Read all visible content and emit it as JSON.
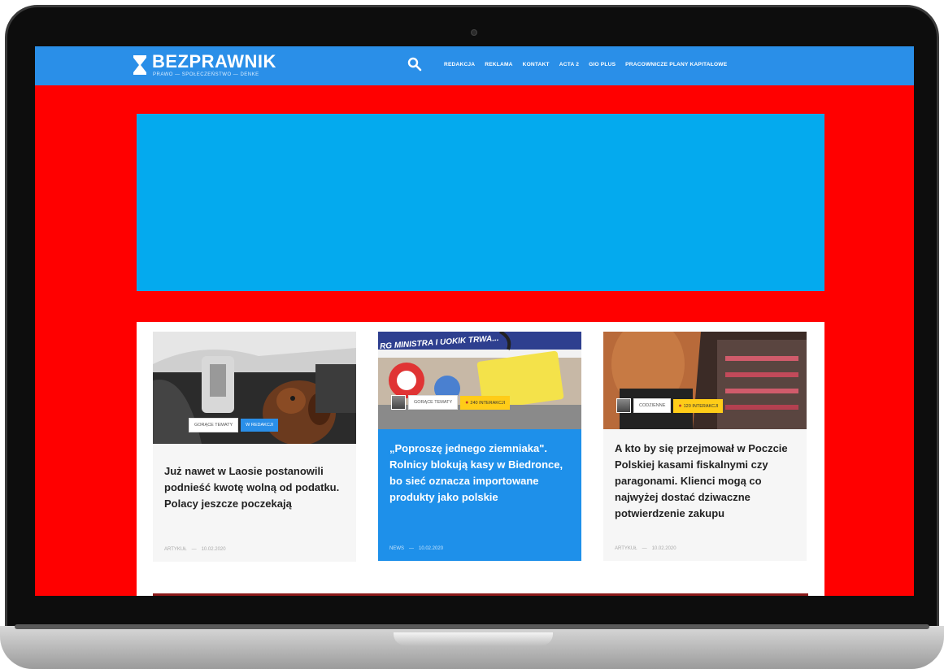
{
  "site": {
    "logo_name": "BEZPRAWNIK",
    "logo_tagline": "PRAWO — SPOŁECZEŃSTWO — DENKE",
    "logo_mark": "X"
  },
  "nav": {
    "items": [
      "REDAKCJA",
      "REKLAMA",
      "KONTAKT",
      "ACTA 2",
      "GIO PLUS",
      "PRACOWNICZE PLANY KAPITAŁOWE"
    ]
  },
  "colors": {
    "header": "#2a8fe8",
    "page_bg": "#ff0000",
    "ad_bg": "#04aaee",
    "highlight_card": "#1e90ea"
  },
  "cards": [
    {
      "title": "Już nawet w Laosie postanowili podnieść kwotę wolną od podatku. Polacy jeszcze poczekają",
      "category": "ARTYKUŁ",
      "date": "10.02.2020",
      "badge_1": "GORĄCE TEMATY",
      "badge_2": "W REDAKCJI"
    },
    {
      "title": "„Poproszę jednego ziemniaka\". Rolnicy blokują kasy w Biedronce, bo sieć oznacza importowane produkty jako polskie",
      "category": "NEWS",
      "date": "10.02.2020",
      "badge_1": "GORĄCE TEMATY",
      "badge_2": "240 INTERAKCJI",
      "img_text": "RG MINISTRA I UOKIK TRWA..."
    },
    {
      "title": "A kto by się przejmował w Poczcie Polskiej kasami fiskalnymi czy paragonami. Klienci mogą co najwyżej dostać dziwaczne potwierdzenie zakupu",
      "category": "ARTYKUŁ",
      "date": "10.02.2020",
      "badge_1": "CODZIENNE",
      "badge_2": "120 INTERAKCJI"
    }
  ]
}
